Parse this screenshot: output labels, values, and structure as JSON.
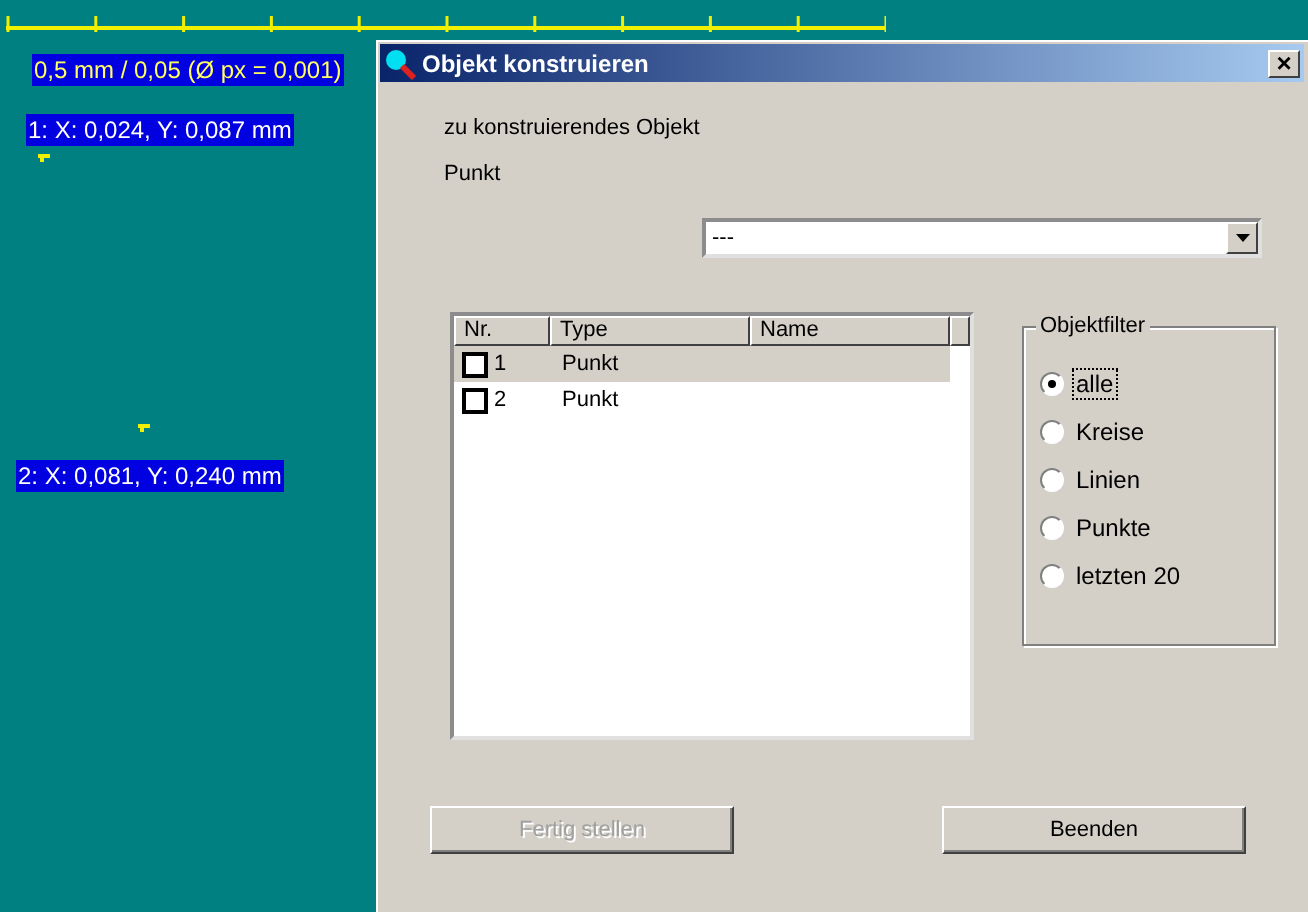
{
  "canvas": {
    "scale_label": "0,5 mm / 0,05 (Ø px = 0,001)",
    "points": [
      {
        "label": "1: X: 0,024, Y: 0,087 mm"
      },
      {
        "label": "2: X: 0,081, Y: 0,240 mm"
      }
    ]
  },
  "dialog": {
    "title": "Objekt konstruieren",
    "close": "×",
    "object_caption": "zu konstruierendes Objekt",
    "object_type": "Punkt",
    "dropdown": {
      "value": "---"
    },
    "list": {
      "columns": [
        "Nr.",
        "Type",
        "Name"
      ],
      "rows": [
        {
          "nr": "1",
          "type": "Punkt",
          "checked": false,
          "selected": true
        },
        {
          "nr": "2",
          "type": "Punkt",
          "checked": false,
          "selected": false
        }
      ]
    },
    "filter": {
      "title": "Objektfilter",
      "options": [
        {
          "label": "alle",
          "selected": true
        },
        {
          "label": "Kreise",
          "selected": false
        },
        {
          "label": "Linien",
          "selected": false
        },
        {
          "label": "Punkte",
          "selected": false
        },
        {
          "label": "letzten 20",
          "selected": false
        }
      ]
    },
    "buttons": [
      {
        "label": "Fertig stellen",
        "disabled": true
      },
      {
        "label": "Beenden",
        "disabled": false
      }
    ]
  }
}
